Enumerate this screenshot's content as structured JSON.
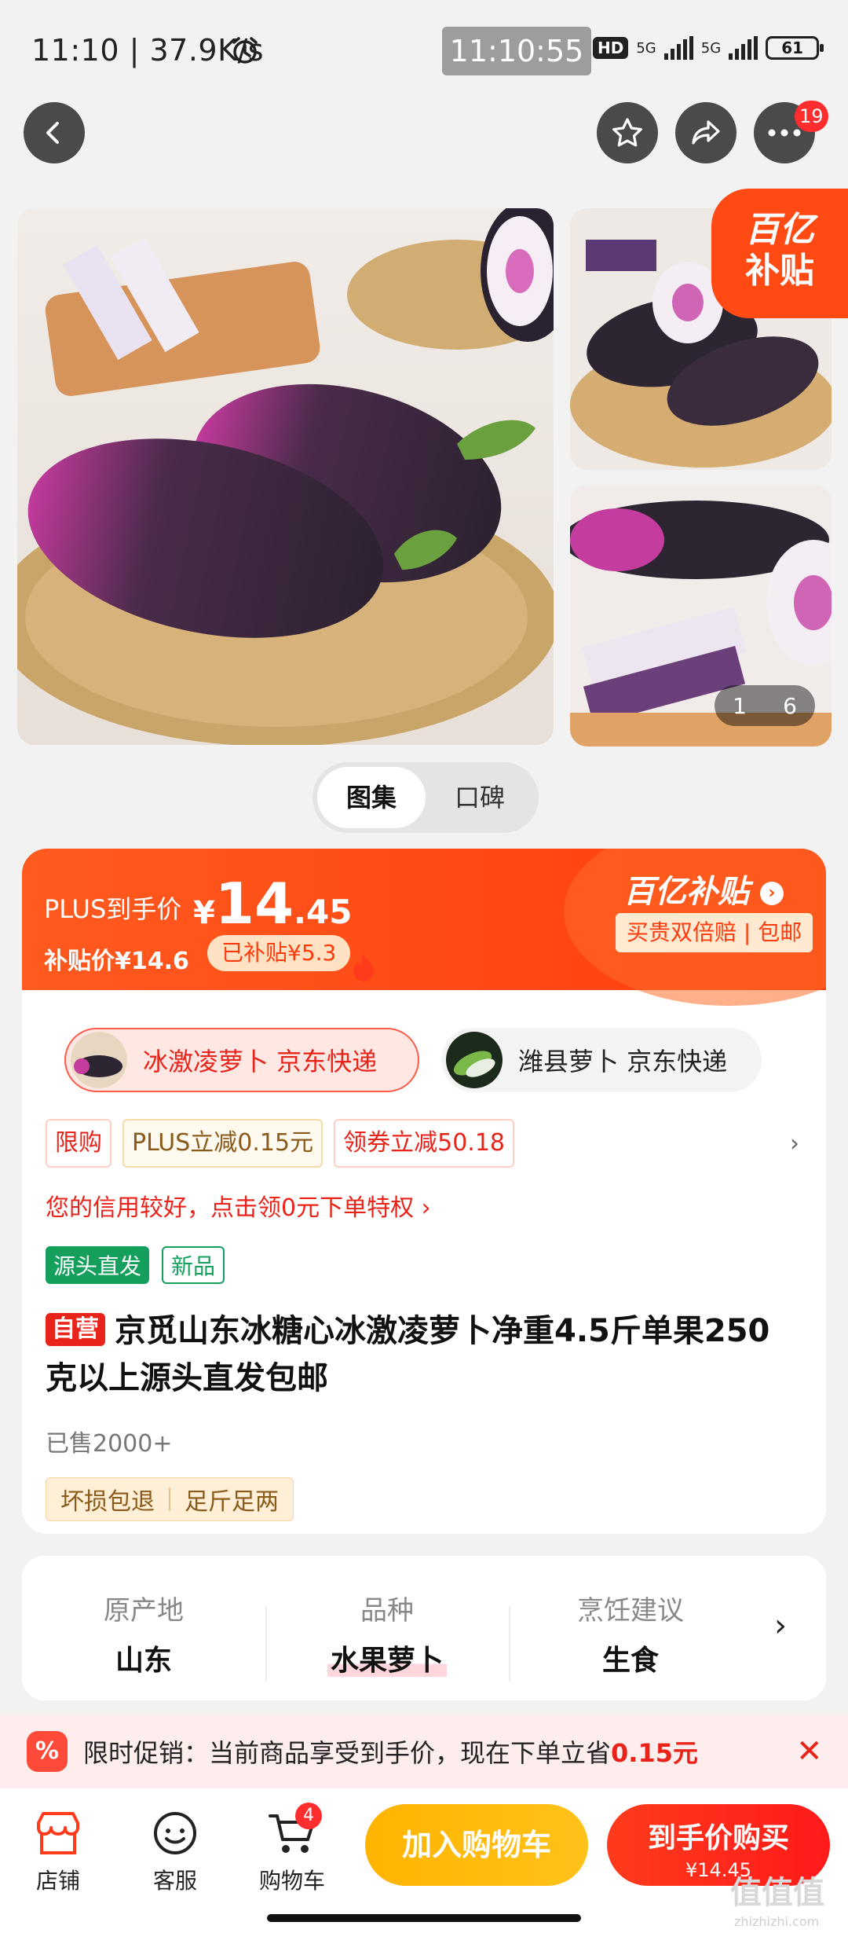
{
  "status_bar": {
    "time_speed": "11:10 | 37.9K/s",
    "clock": "11:10:55",
    "hd": "HD",
    "net1": "5G",
    "net2": "5G",
    "battery": "61"
  },
  "nav": {
    "back_icon": "chevron-left-icon",
    "favorite_icon": "star-icon",
    "share_icon": "share-icon",
    "more_icon": "more-icon",
    "more_badge": "19"
  },
  "gallery": {
    "subsidy_line1": "百亿",
    "subsidy_line2": "补贴",
    "pager_current": "1",
    "pager_total": "6"
  },
  "tabs": [
    "图集",
    "口碑"
  ],
  "price": {
    "plus_label": "PLUS到手价",
    "currency": "¥",
    "price_int": "14",
    "price_dec": ".45",
    "subsidy_price": "补贴价¥14.6",
    "subsidy_chip": "已补贴¥5.3",
    "brand": "百亿补贴",
    "guarantee": "买贵双倍赔 | 包邮"
  },
  "variants": [
    {
      "label": "冰激凌萝卜 京东快递",
      "selected": true
    },
    {
      "label": "潍县萝卜 京东快递",
      "selected": false
    }
  ],
  "promo_tags": [
    "限购",
    "PLUS立减0.15元",
    "领券立减50.18"
  ],
  "credit_line": "您的信用较好，点击领0元下单特权 ›",
  "labels": [
    "源头直发",
    "新品"
  ],
  "title": {
    "tag": "自营",
    "text": "京觅山东冰糖心冰激凌萝卜净重4.5斤单果250克以上源头直发包邮"
  },
  "sold": "已售2000+",
  "service_tags": [
    "坏损包退",
    "足斤足两"
  ],
  "attributes": [
    {
      "key": "原产地",
      "value": "山东"
    },
    {
      "key": "品种",
      "value": "水果萝卜"
    },
    {
      "key": "烹饪建议",
      "value": "生食"
    }
  ],
  "promo_bar": {
    "icon_text": "%",
    "text": "限时促销：当前商品享受到手价，现在下单立省",
    "amount": "0.15元"
  },
  "bottom": {
    "shop": "店铺",
    "service": "客服",
    "cart": "购物车",
    "cart_badge": "4",
    "add_cart": "加入购物车",
    "buy": "到手价购买",
    "buy_price": "¥14.45"
  },
  "watermark": {
    "logo": "值值值",
    "url": "zhizhizhi.com"
  },
  "colors": {
    "brand_orange": "#ff4a14",
    "price_red": "#e8231a",
    "cart_yellow": "#ffb400",
    "tag_green": "#14a05c"
  }
}
